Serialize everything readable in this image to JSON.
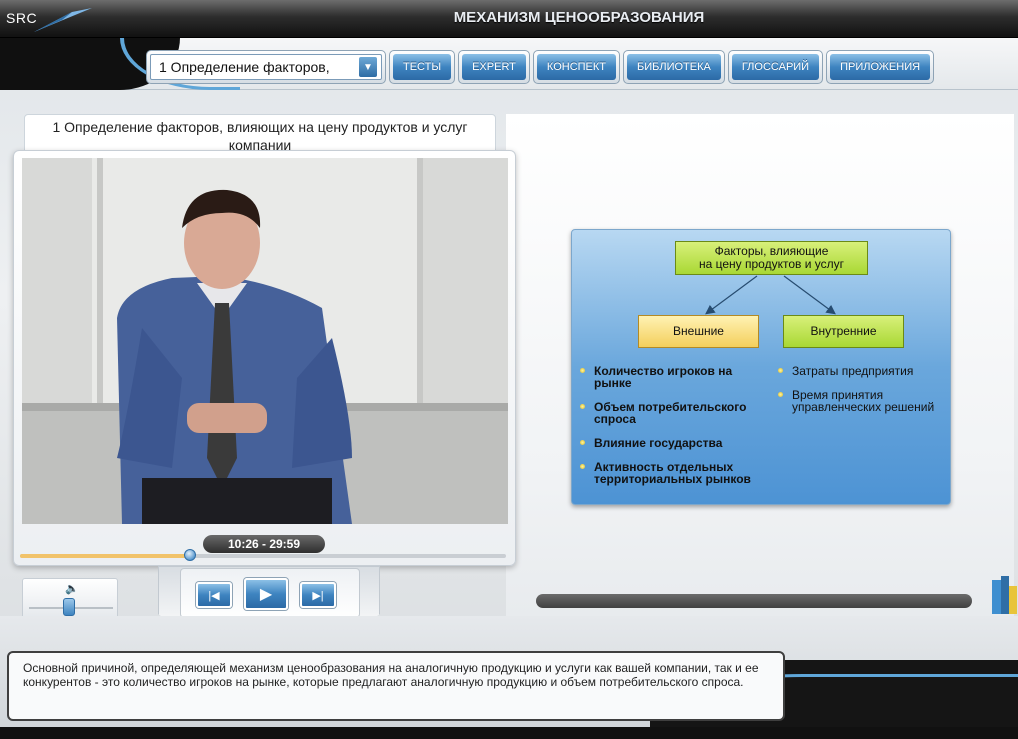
{
  "header": {
    "logo_text": "SRC",
    "title": "МЕХАНИЗМ ЦЕНООБРАЗОВАНИЯ"
  },
  "toolbar": {
    "lesson_select_value": "1 Определение факторов,",
    "buttons": [
      "ТЕСТЫ",
      "EXPERT",
      "КОНСПЕКТ",
      "БИБЛИОТЕКА",
      "ГЛОССАРИЙ",
      "ПРИЛОЖЕНИЯ"
    ]
  },
  "slide": {
    "title": "1 Определение факторов, влияющих на цену продуктов и услуг компании"
  },
  "player": {
    "time": "10:26 - 29:59",
    "progress": 0.35,
    "volume": 0.5,
    "controls": {
      "prev": "prev-icon",
      "play": "play-icon",
      "next": "next-icon"
    }
  },
  "diagram": {
    "root": "Факторы, влияющие\nна цену продуктов и услуг",
    "left_node": "Внешние",
    "right_node": "Внутренние",
    "left_items": [
      "Количество игроков на рынке",
      "Объем потребительского спроса",
      "Влияние государства",
      "Активность отдельных территориальных рынков"
    ],
    "right_items": [
      "Затраты предприятия",
      "Время принятия управленческих решений"
    ]
  },
  "caption": {
    "text": "Основной причиной, определяющей механизм ценообразования на аналогичную продукцию и услуги как вашей компании, так и ее конкурентов - это количество игроков на рынке, которые предлагают аналогичную продукцию и объем потребительского спроса."
  },
  "colors": {
    "accent_blue": "#3e84c0",
    "node_green": "#a9d834",
    "node_yellow": "#f4cf5c",
    "progress": "#f1c36a"
  }
}
